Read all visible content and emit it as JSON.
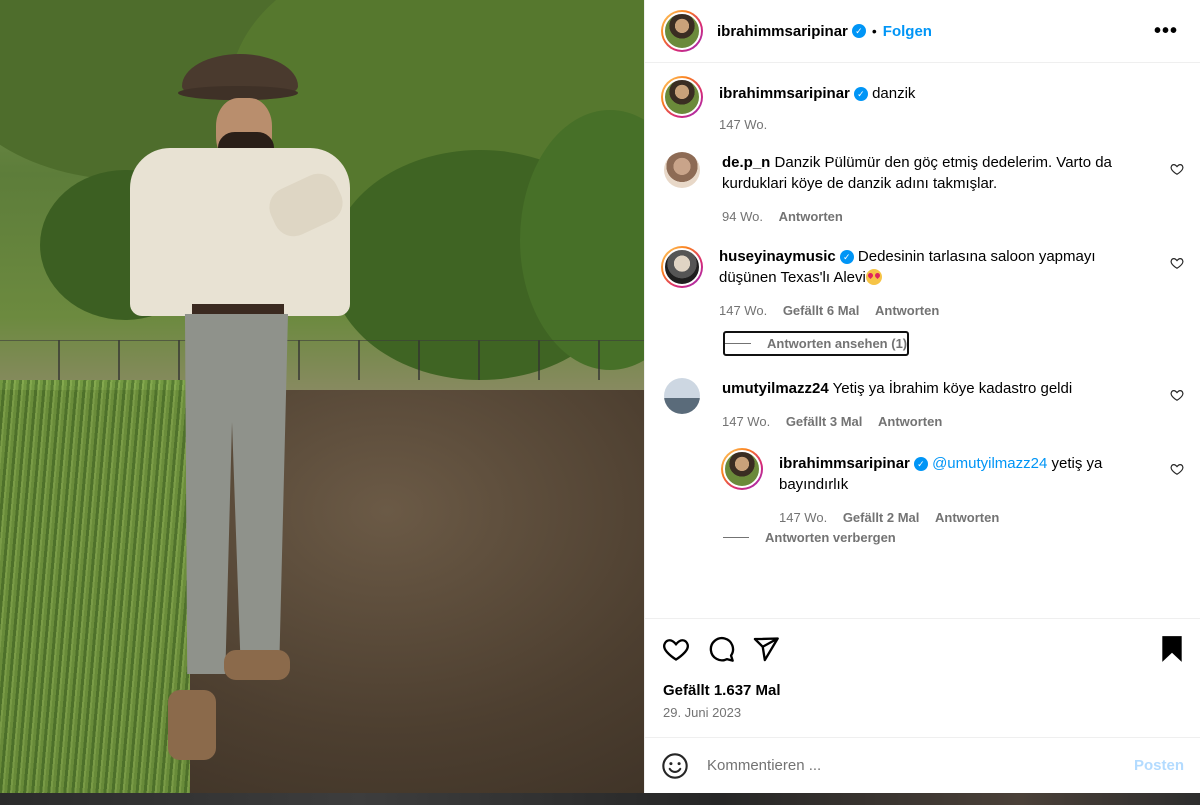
{
  "post": {
    "author": "ibrahimmsaripinar",
    "follow_label": "Folgen",
    "caption_author": "ibrahimmsaripinar",
    "caption_text": "danzik",
    "caption_age": "147 Wo."
  },
  "comments": [
    {
      "user": "de.p_n",
      "text": "Danzik Pülümür den göç etmiş dedelerim. Varto da kurduklari köye de danzik adını takmışlar.",
      "age": "94 Wo.",
      "reply_label": "Antworten"
    },
    {
      "user": "huseyinaymusic",
      "text": "Dedesinin tarlasına saloon yapmayı düşünen Texas'lı Alevi",
      "emoji": "smiling-face-with-heart-eyes",
      "age": "147 Wo.",
      "likes": "Gefällt 6 Mal",
      "reply_label": "Antworten",
      "view_replies": "Antworten ansehen (1)"
    },
    {
      "user": "umutyilmazz24",
      "text": "Yetiş ya İbrahim köye kadastro geldi",
      "age": "147 Wo.",
      "likes": "Gefällt 3 Mal",
      "reply_label": "Antworten"
    }
  ],
  "reply": {
    "user": "ibrahimmsaripinar",
    "mention": "@umutyilmazz24",
    "text": "yetiş ya bayındırlık",
    "age": "147 Wo.",
    "likes": "Gefällt 2 Mal",
    "reply_label": "Antworten",
    "hide_replies": "Antworten verbergen"
  },
  "actions": {
    "likes": "Gefällt 1.637 Mal",
    "date": "29. Juni 2023"
  },
  "compose": {
    "placeholder": "Kommentieren ...",
    "post_label": "Posten"
  },
  "icons": {
    "like": "heart-icon",
    "comment": "comment-icon",
    "share": "share-icon",
    "save": "bookmark-icon",
    "more": "more-options-icon",
    "emoji": "emoji-icon",
    "verified": "verified-badge-icon"
  },
  "colors": {
    "accent": "#0095f6",
    "muted": "#737373",
    "post_disabled": "#b3dbff"
  }
}
